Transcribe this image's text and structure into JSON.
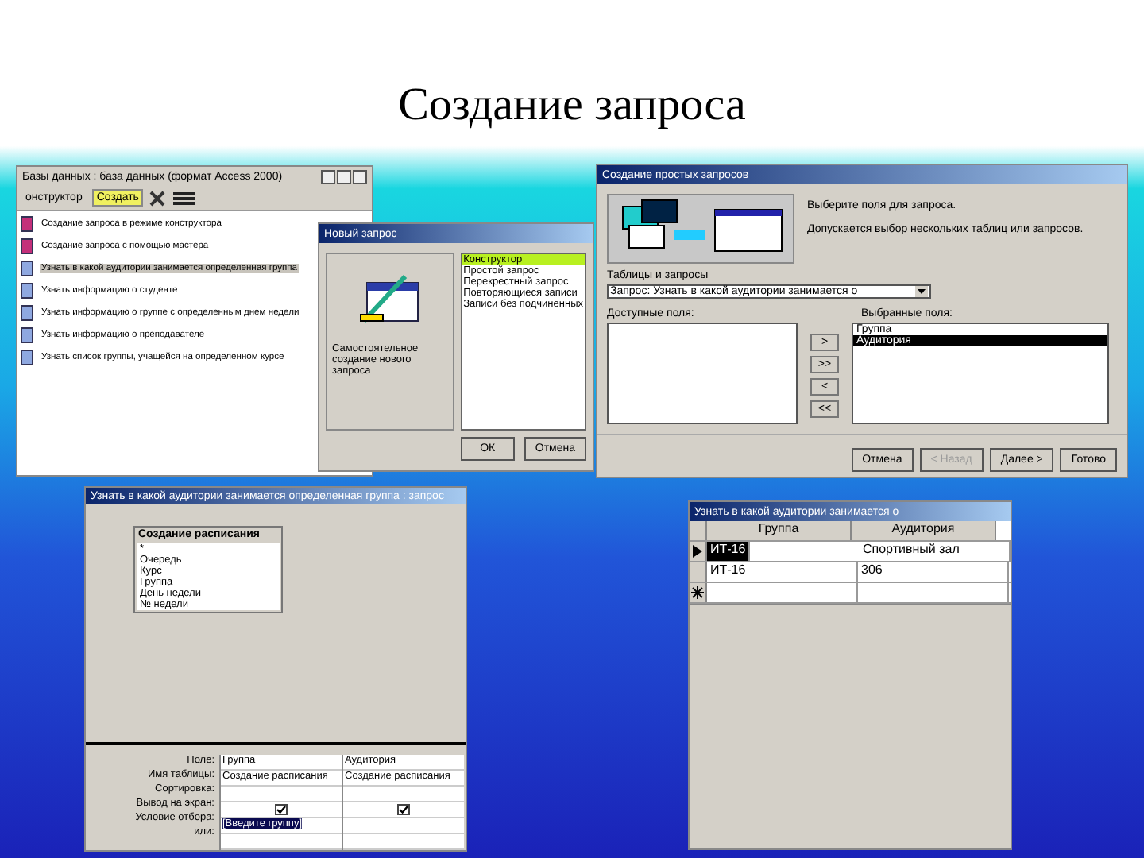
{
  "slide_title": "Создание запроса",
  "db_window": {
    "title": "Базы данных : база данных (формат Access 2000)",
    "toolbar": [
      {
        "label": "онструктор",
        "selected": false
      },
      {
        "label": "Создать",
        "selected": true
      }
    ],
    "items": [
      {
        "kind": "wizard",
        "label": "Создание запроса в режиме конструктора",
        "selected": false
      },
      {
        "kind": "wizard",
        "label": "Создание запроса с помощью мастера",
        "selected": false
      },
      {
        "kind": "query",
        "label": "Узнать в какой аудитории занимается определенная группа",
        "selected": true
      },
      {
        "kind": "query",
        "label": "Узнать информацию о студенте",
        "selected": false
      },
      {
        "kind": "query",
        "label": "Узнать информацию о группе с определенным днем недели",
        "selected": false
      },
      {
        "kind": "query",
        "label": "Узнать информацию о преподавателе",
        "selected": false
      },
      {
        "kind": "query",
        "label": "Узнать список группы, учащейся на определенном курсе",
        "selected": false
      }
    ]
  },
  "new_query_dialog": {
    "title": "Новый запрос",
    "description": "Самостоятельное создание нового запроса",
    "options": [
      {
        "label": "Конструктор",
        "selected": true
      },
      {
        "label": "Простой запрос",
        "selected": false
      },
      {
        "label": "Перекрестный запрос",
        "selected": false
      },
      {
        "label": "Повторяющиеся записи",
        "selected": false
      },
      {
        "label": "Записи без подчиненных",
        "selected": false
      }
    ],
    "buttons": [
      {
        "label": "ОК"
      },
      {
        "label": "Отмена"
      }
    ]
  },
  "simple_query_wizard": {
    "title": "Создание простых запросов",
    "hint_1": "Выберите поля для запроса.",
    "hint_2": "Допускается выбор нескольких таблиц или запросов.",
    "tables_label": "Таблицы и запросы",
    "tables_value": "Запрос: Узнать в какой аудитории занимается о",
    "available_label": "Доступные поля:",
    "selected_label": "Выбранные поля:",
    "selected_fields": [
      {
        "label": "Группа",
        "selected": false
      },
      {
        "label": "Аудитория",
        "selected": true
      }
    ],
    "move_buttons": [
      {
        "label": ">"
      },
      {
        "label": ">>"
      },
      {
        "label": "<"
      },
      {
        "label": "<<"
      }
    ],
    "buttons": [
      {
        "label": "Отмена",
        "disabled": false
      },
      {
        "label": "< Назад",
        "disabled": true
      },
      {
        "label": "Далее >",
        "disabled": false
      },
      {
        "label": "Готово",
        "disabled": false
      }
    ]
  },
  "query_designer": {
    "title": "Узнать в какой аудитории занимается определенная группа : запрос",
    "table_title": "Создание расписания",
    "fields": [
      "*",
      "Очередь",
      "Курс",
      "Группа",
      "День недели",
      "№ недели"
    ],
    "row_labels": [
      "Поле:",
      "Имя таблицы:",
      "Сортировка:",
      "Вывод на экран:",
      "Условие отбора:",
      "или:"
    ],
    "columns": [
      {
        "field": "Группа",
        "table": "Создание расписания",
        "checked": true,
        "criteria": "[Введите группу]"
      },
      {
        "field": "Аудитория",
        "table": "Создание расписания",
        "checked": true
      }
    ]
  },
  "query_datasheet": {
    "title": "Узнать в какой аудитории занимается о",
    "columns": [
      "Группа",
      "Аудитория"
    ],
    "rows": [
      {
        "cells": [
          "ИТ-16",
          "Спортивный зал"
        ],
        "selected": true
      },
      {
        "cells": [
          "ИТ-16",
          "306"
        ],
        "selected": false
      }
    ]
  }
}
